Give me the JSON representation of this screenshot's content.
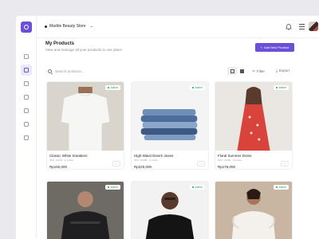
{
  "store": {
    "name": "Marble Beauty Store"
  },
  "page": {
    "title": "My Products",
    "subtitle": "View and manage all your products in one place.",
    "add_button": "Add New Product"
  },
  "toolbar": {
    "search_placeholder": "Search products...",
    "filter_label": "Filter",
    "export_label": "Export"
  },
  "sidebar": {
    "items": [
      "home-icon",
      "box-icon",
      "clipboard-icon",
      "users-icon",
      "chart-icon",
      "calendar-icon",
      "message-icon"
    ]
  },
  "products": [
    {
      "name": "Classic White Sneakers",
      "meta": "SKU: 10234 · 1 Colour",
      "price": "Rp150,000",
      "status": "Active"
    },
    {
      "name": "High-Waist Denim Jeans",
      "meta": "SKU: 10235 · 2 Colour",
      "price": "Rp220,000",
      "status": "Active"
    },
    {
      "name": "Floral Summer Dress",
      "meta": "SKU: 10236 · 3 Colour",
      "price": "Rp175,000",
      "status": "Active"
    },
    {
      "name": "",
      "meta": "",
      "price": "",
      "status": "Active"
    },
    {
      "name": "",
      "meta": "",
      "price": "",
      "status": "Active"
    },
    {
      "name": "",
      "meta": "",
      "price": "",
      "status": "Active"
    }
  ],
  "colors": {
    "accent": "#6b4fd8",
    "active": "#1f9d55"
  }
}
